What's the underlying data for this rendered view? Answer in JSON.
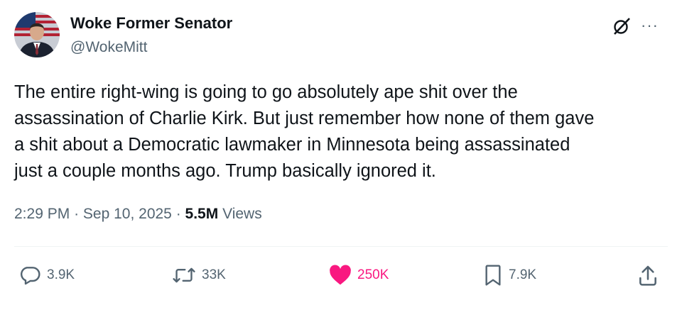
{
  "author": {
    "display_name": "Woke Former Senator",
    "handle": "@WokeMitt"
  },
  "tweet": {
    "text": "The entire right-wing is going to go absolutely ape shit over the\nassassination of Charlie Kirk. But just remember how none of them gave\na shit about a Democratic lawmaker in Minnesota being assassinated\njust a couple months ago. Trump basically ignored it.",
    "time": "2:29 PM",
    "separator": "·",
    "date": "Sep 10, 2025",
    "views_count": "5.5M",
    "views_label": "Views"
  },
  "actions": {
    "replies": "3.9K",
    "reposts": "33K",
    "likes": "250K",
    "bookmarks": "7.9K"
  },
  "colors": {
    "like_active": "#f91880",
    "secondary_text": "#536471",
    "primary_text": "#0f1419"
  },
  "icons": [
    "grok-icon",
    "more-icon",
    "reply-icon",
    "repost-icon",
    "heart-icon",
    "bookmark-icon",
    "share-icon"
  ]
}
